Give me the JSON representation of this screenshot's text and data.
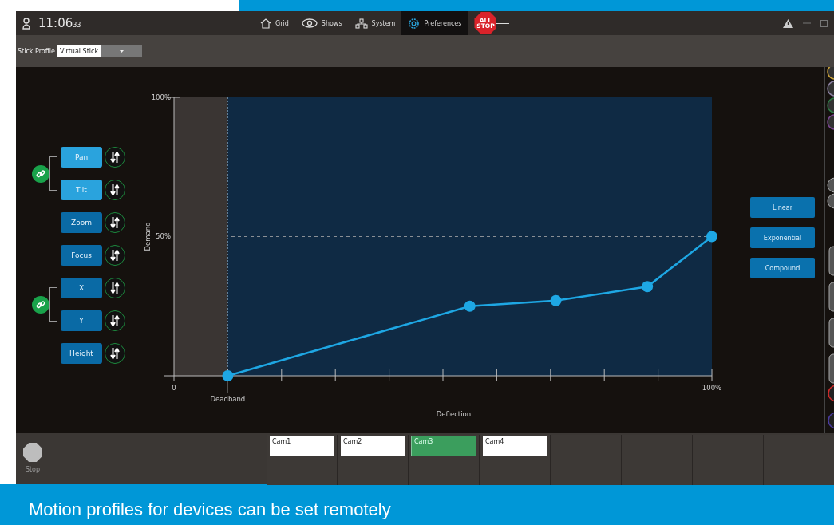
{
  "title_bar": {
    "time": "11:06",
    "seconds": "33",
    "nav": [
      {
        "label": "Grid",
        "kind": "home",
        "selected": false
      },
      {
        "label": "Shows",
        "kind": "eye",
        "selected": false
      },
      {
        "label": "System",
        "kind": "network",
        "selected": false
      },
      {
        "label": "Preferences",
        "kind": "gear",
        "selected": true
      }
    ],
    "all_stop": "ALL STOP"
  },
  "toolbar": {
    "label": "Stick Profile",
    "dropdown": "Virtual Stick"
  },
  "axis_groups": [
    {
      "linked": true,
      "axes": [
        {
          "label": "Pan",
          "selected": true
        },
        {
          "label": "Tilt",
          "selected": true
        }
      ]
    },
    {
      "linked": false,
      "axes": [
        {
          "label": "Zoom",
          "selected": false
        }
      ]
    },
    {
      "linked": false,
      "axes": [
        {
          "label": "Focus",
          "selected": false
        }
      ]
    },
    {
      "linked": true,
      "axes": [
        {
          "label": "X",
          "selected": false
        },
        {
          "label": "Y",
          "selected": false
        }
      ]
    },
    {
      "linked": false,
      "axes": [
        {
          "label": "Height",
          "selected": false
        }
      ]
    }
  ],
  "chart_data": {
    "type": "line",
    "xlabel": "Deflection",
    "ylabel": "Demand",
    "x": [
      10,
      55,
      71,
      88,
      100
    ],
    "series": [
      {
        "color": "#1ea7e4",
        "marker": "o",
        "values": [
          0,
          25,
          27,
          32,
          50
        ]
      }
    ],
    "bands": [
      {
        "axis": "x",
        "from": 0,
        "to": 10,
        "color": "#3a3533"
      }
    ],
    "ref_lines": [
      {
        "axis": "x",
        "value": 10
      }
    ],
    "xlim": [
      0,
      100
    ],
    "ylim": [
      0,
      100
    ],
    "xticks": [
      {
        "value": 0,
        "label": "0"
      },
      {
        "value": 100,
        "label": "100%"
      }
    ],
    "yticks": [
      {
        "value": 50,
        "label": "50%"
      },
      {
        "value": 100,
        "label": "100%"
      }
    ],
    "annotations": [
      {
        "x": 10,
        "text": "Deadband"
      }
    ]
  },
  "profiles": [
    "Linear",
    "Exponential",
    "Compound"
  ],
  "bottom": {
    "stop": "Stop",
    "cameras": [
      {
        "label": "Cam1",
        "selected": false
      },
      {
        "label": "Cam2",
        "selected": false
      },
      {
        "label": "Cam3",
        "selected": true
      },
      {
        "label": "Cam4",
        "selected": false
      }
    ]
  },
  "caption": "Motion profiles for devices can be set remotely"
}
